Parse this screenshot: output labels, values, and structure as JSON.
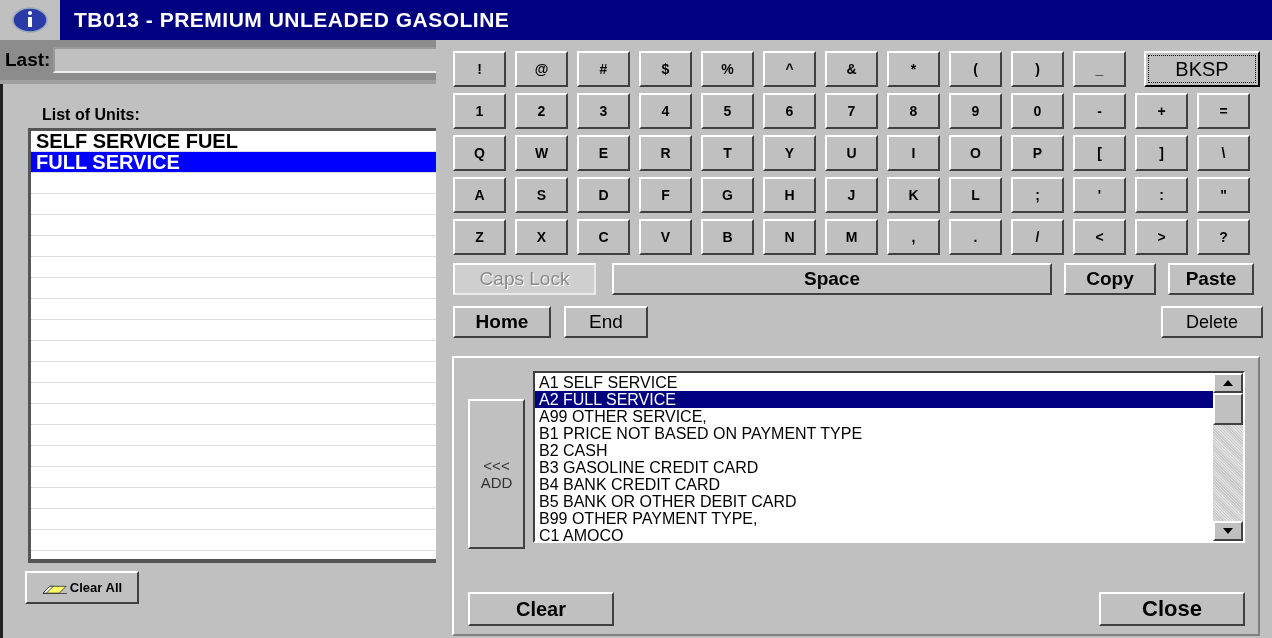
{
  "window": {
    "title": "TB013 - PREMIUM UNLEADED GASOLINE"
  },
  "last_field": {
    "label": "Last:"
  },
  "units": {
    "label": "List of Units:",
    "items": [
      {
        "text": "SELF SERVICE FUEL",
        "selected": false
      },
      {
        "text": "FULL SERVICE",
        "selected": true
      }
    ]
  },
  "clear_all_button": "Clear All",
  "keyboard": {
    "rows": [
      [
        "!",
        "@",
        "#",
        "$",
        "%",
        "^",
        "&",
        "*",
        "(",
        ")",
        "_"
      ],
      [
        "1",
        "2",
        "3",
        "4",
        "5",
        "6",
        "7",
        "8",
        "9",
        "0",
        "-",
        "+",
        "="
      ],
      [
        "Q",
        "W",
        "E",
        "R",
        "T",
        "Y",
        "U",
        "I",
        "O",
        "P",
        "[",
        "]",
        "\\"
      ],
      [
        "A",
        "S",
        "D",
        "F",
        "G",
        "H",
        "J",
        "K",
        "L",
        ";",
        "'",
        ":",
        "\""
      ],
      [
        "Z",
        "X",
        "C",
        "V",
        "B",
        "N",
        "M",
        ",",
        ".",
        "/",
        "<",
        ">",
        "?"
      ]
    ],
    "backspace_key": {
      "label": "BKSP",
      "focused": true
    },
    "controls": [
      {
        "label": "Caps Lock",
        "disabled": true
      },
      {
        "label": "Space",
        "disabled": false
      },
      {
        "label": "Copy",
        "disabled": false
      },
      {
        "label": "Paste",
        "disabled": false
      },
      {
        "label": "Home",
        "disabled": false
      },
      {
        "label": "End",
        "disabled": false
      },
      {
        "label": "Delete",
        "disabled": false
      }
    ]
  },
  "add_button": [
    "<<<",
    "ADD"
  ],
  "codes": [
    {
      "text": "A1 SELF SERVICE",
      "selected": false
    },
    {
      "text": "A2 FULL SERVICE",
      "selected": true
    },
    {
      "text": "A99 OTHER SERVICE,",
      "selected": false
    },
    {
      "text": "B1 PRICE NOT BASED ON PAYMENT TYPE",
      "selected": false
    },
    {
      "text": "B2 CASH",
      "selected": false
    },
    {
      "text": "B3 GASOLINE CREDIT CARD",
      "selected": false
    },
    {
      "text": "B4 BANK CREDIT CARD",
      "selected": false
    },
    {
      "text": "B5 BANK OR OTHER DEBIT CARD",
      "selected": false
    },
    {
      "text": "B99 OTHER PAYMENT TYPE,",
      "selected": false
    },
    {
      "text": "C1 AMOCO",
      "selected": false
    }
  ],
  "clear_button": "Clear",
  "close_button": "Close"
}
